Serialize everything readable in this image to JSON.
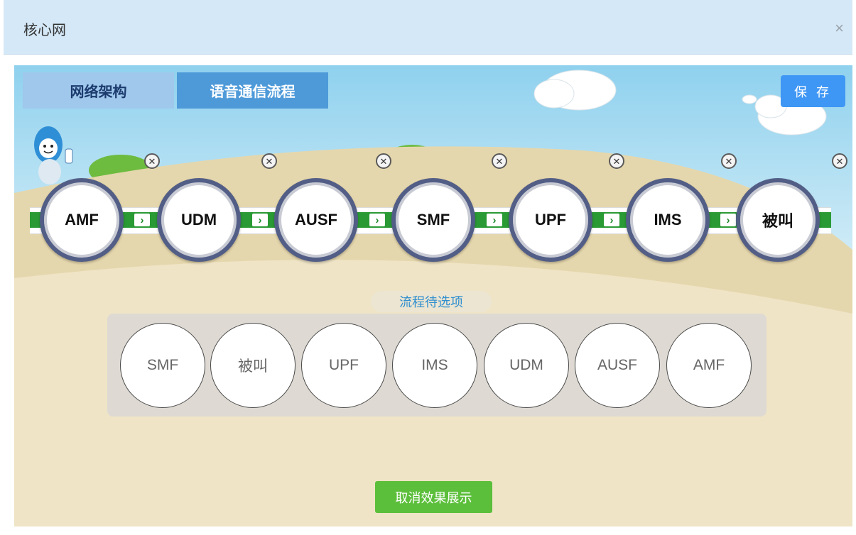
{
  "dialog": {
    "title": "核心网",
    "close_glyph": "×"
  },
  "tabs": [
    {
      "label": "网络架构",
      "active": false
    },
    {
      "label": "语音通信流程",
      "active": true
    }
  ],
  "save_label": "保 存",
  "flow": {
    "nodes": [
      {
        "label": "AMF"
      },
      {
        "label": "UDM"
      },
      {
        "label": "AUSF"
      },
      {
        "label": "SMF"
      },
      {
        "label": "UPF"
      },
      {
        "label": "IMS"
      },
      {
        "label": "被叫"
      }
    ],
    "remove_glyph": "✕",
    "arrow_glyph": "›"
  },
  "options": {
    "label": "流程待选项",
    "items": [
      "SMF",
      "被叫",
      "UPF",
      "IMS",
      "UDM",
      "AUSF",
      "AMF"
    ]
  },
  "cancel_label": "取消效果展示",
  "colors": {
    "title_bar": "#d5e8f7",
    "tab_active": "#4e9ad9",
    "tab_inactive": "#9fc8ec",
    "save_button": "#3f97f5",
    "flow_band": "#2a9a34",
    "node_ring": "#525e86",
    "cancel_button": "#5cbf3b"
  },
  "icons": [
    "close-icon",
    "remove-icon",
    "chevron-right-icon",
    "mascot-icon",
    "cloud-icon"
  ]
}
